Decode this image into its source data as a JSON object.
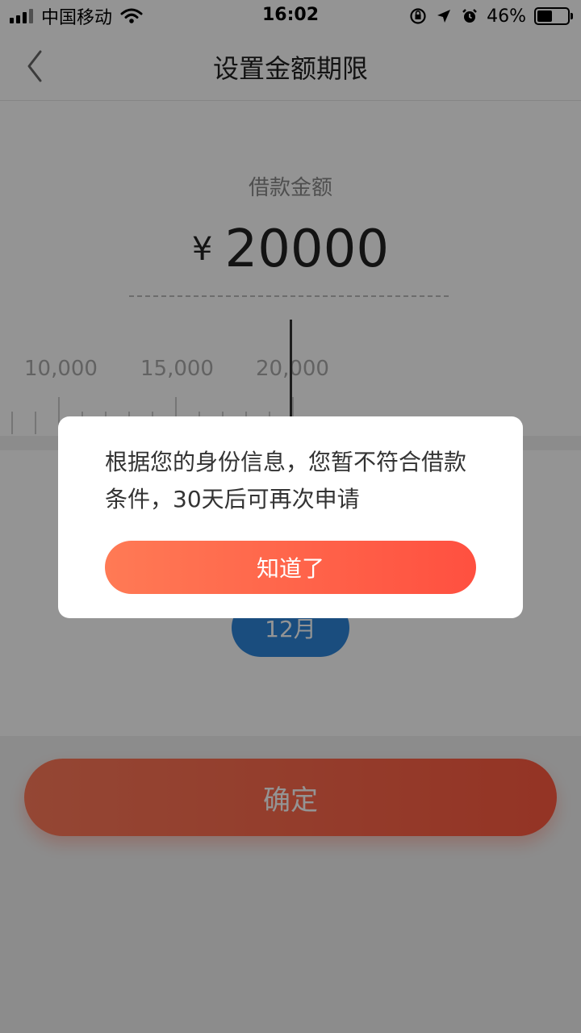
{
  "status_bar": {
    "carrier": "中国移动",
    "time": "16:02",
    "battery_percent": "46%",
    "battery_level": 0.46
  },
  "nav": {
    "title": "设置金额期限"
  },
  "amount": {
    "label": "借款金额",
    "currency": "¥",
    "value": "20000"
  },
  "ruler": {
    "labels": [
      "10,000",
      "15,000",
      "20,000"
    ],
    "selected": 20000
  },
  "period": {
    "selected_label": "12月"
  },
  "confirm_button": {
    "label": "确定"
  },
  "dialog": {
    "message": "根据您的身份信息，您暂不符合借款条件，30天后可再次申请",
    "button_label": "知道了"
  },
  "colors": {
    "accent": "#ff5a40",
    "period_blue": "#2e86d9"
  }
}
